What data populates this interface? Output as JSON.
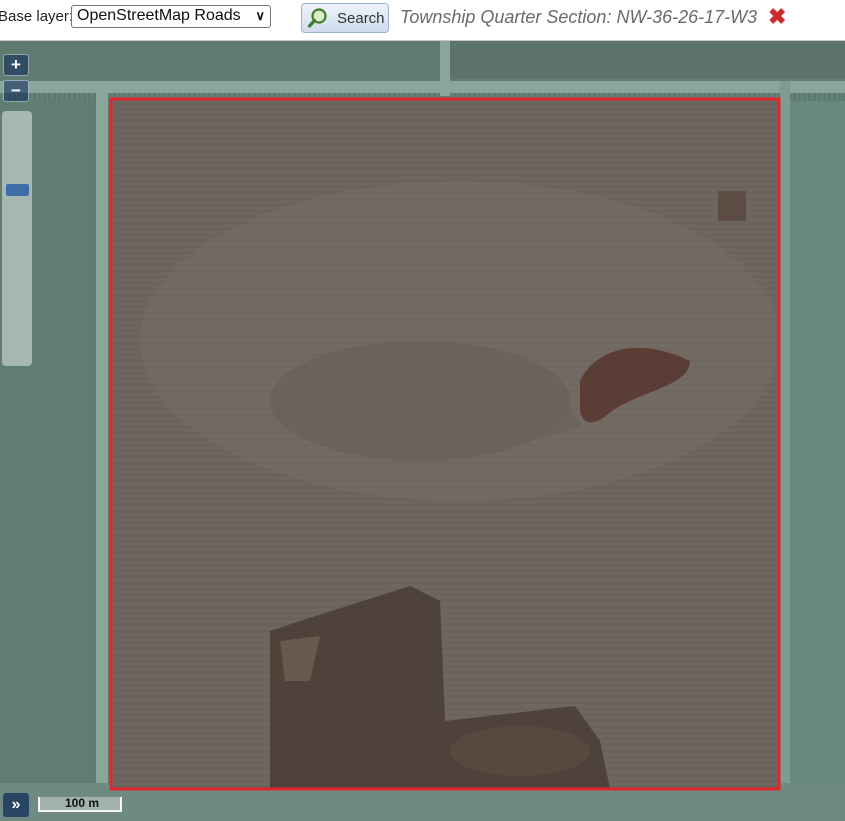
{
  "toolbar": {
    "base_layer_label": "Base layer:",
    "base_layer_selected": "OpenStreetMap Roads",
    "search_label": "Search",
    "title": "Township Quarter Section: NW-36-26-17-W3",
    "search_icon": "magnifier-icon",
    "close_icon": "close-icon"
  },
  "map": {
    "zoom_in_label": "+",
    "zoom_out_label": "−",
    "zoom_level_fraction": 0.3,
    "expand_label": "»",
    "scale_label": "100 m",
    "boundary_color": "#e3262b",
    "imagery": "satellite"
  }
}
